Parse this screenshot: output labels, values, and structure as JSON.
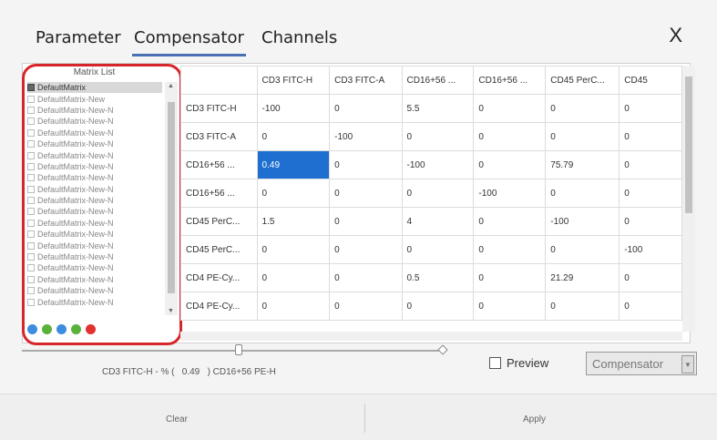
{
  "tabs": [
    {
      "label": "Parameter"
    },
    {
      "label": "Compensator"
    },
    {
      "label": "Channels"
    }
  ],
  "close_label": "X",
  "matrix_list": {
    "title": "Matrix List",
    "items": [
      {
        "label": "DefaultMatrix"
      },
      {
        "label": "DefaultMatrix-New"
      },
      {
        "label": "DefaultMatrix-New-N"
      },
      {
        "label": "DefaultMatrix-New-N"
      },
      {
        "label": "DefaultMatrix-New-N"
      },
      {
        "label": "DefaultMatrix-New-N"
      },
      {
        "label": "DefaultMatrix-New-N"
      },
      {
        "label": "DefaultMatrix-New-N"
      },
      {
        "label": "DefaultMatrix-New-N"
      },
      {
        "label": "DefaultMatrix-New-N"
      },
      {
        "label": "DefaultMatrix-New-N"
      },
      {
        "label": "DefaultMatrix-New-N"
      },
      {
        "label": "DefaultMatrix-New-N"
      },
      {
        "label": "DefaultMatrix-New-N"
      },
      {
        "label": "DefaultMatrix-New-N"
      },
      {
        "label": "DefaultMatrix-New-N"
      },
      {
        "label": "DefaultMatrix-New-N"
      },
      {
        "label": "DefaultMatrix-New-N"
      },
      {
        "label": "DefaultMatrix-New-N"
      },
      {
        "label": "DefaultMatrix-New-N"
      }
    ],
    "tools": [
      {
        "icon": "add-icon",
        "color": "#3c8de0"
      },
      {
        "icon": "copy-icon",
        "color": "#59b23a"
      },
      {
        "icon": "save-icon",
        "color": "#3c8de0"
      },
      {
        "icon": "import-icon",
        "color": "#59b23a"
      },
      {
        "icon": "delete-icon",
        "color": "#e0322f"
      }
    ]
  },
  "grid": {
    "columns": [
      "",
      "CD3 FITC-H",
      "CD3 FITC-A",
      "CD16+56 ...",
      "CD16+56 ...",
      "CD45 PerC...",
      "CD45"
    ],
    "rows": [
      {
        "label": "CD3 FITC-H",
        "cells": [
          "-100",
          "0",
          "5.5",
          "0",
          "0",
          "0"
        ]
      },
      {
        "label": "CD3 FITC-A",
        "cells": [
          "0",
          "-100",
          "0",
          "0",
          "0",
          "0"
        ]
      },
      {
        "label": "CD16+56 ...",
        "cells": [
          "0.49",
          "0",
          "-100",
          "0",
          "75.79",
          "0"
        ]
      },
      {
        "label": "CD16+56 ...",
        "cells": [
          "0",
          "0",
          "0",
          "-100",
          "0",
          "0"
        ]
      },
      {
        "label": "CD45 PerC...",
        "cells": [
          "1.5",
          "0",
          "4",
          "0",
          "-100",
          "0"
        ]
      },
      {
        "label": "CD45 PerC...",
        "cells": [
          "0",
          "0",
          "0",
          "0",
          "0",
          "-100"
        ]
      },
      {
        "label": "CD4 PE-Cy...",
        "cells": [
          "0",
          "0",
          "0.5",
          "0",
          "21.29",
          "0"
        ]
      },
      {
        "label": "CD4 PE-Cy...",
        "cells": [
          "0",
          "0",
          "0",
          "0",
          "0",
          "0"
        ]
      }
    ],
    "selected": {
      "row": 2,
      "col": 0
    }
  },
  "status_text": "CD3 FITC-H - % (   0.49   ) CD16+56 PE-H",
  "preview_label": "Preview",
  "preview_checked": false,
  "compensator_select": "Compensator",
  "footer": {
    "clear_label": "Clear",
    "apply_label": "Apply"
  }
}
